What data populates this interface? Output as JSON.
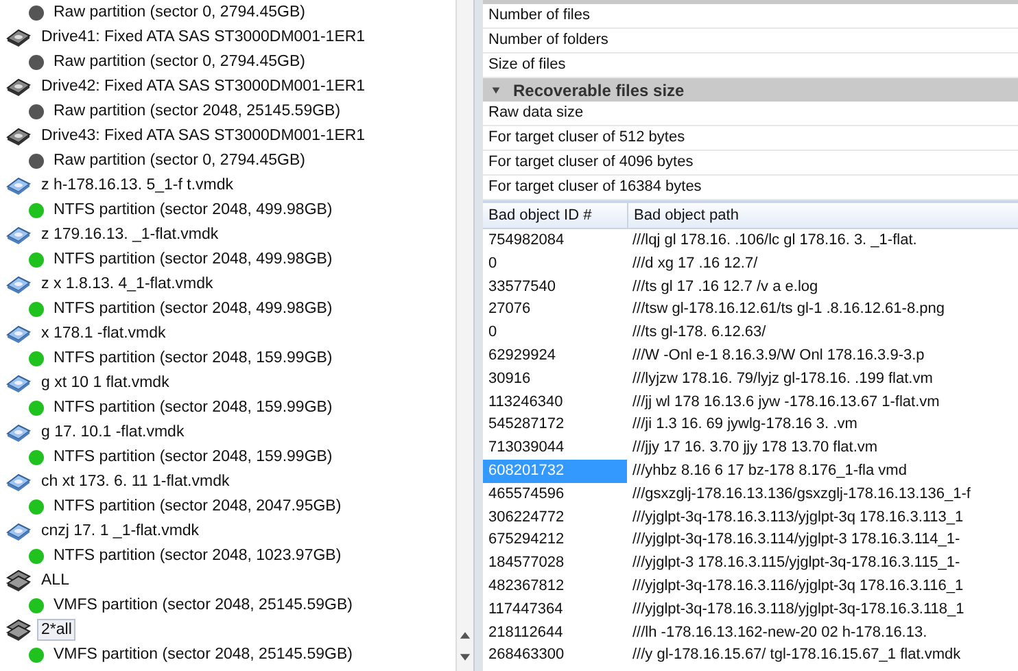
{
  "tree": [
    {
      "kind": "partition",
      "label": "Raw partition (sector 0, 2794.45GB)",
      "color": "#555555",
      "selected": false
    },
    {
      "kind": "drive",
      "label": "Drive41: Fixed ATA SAS ST3000DM001-1ER1",
      "selected": false,
      "children": [
        {
          "kind": "partition",
          "label": "Raw partition (sector 0, 2794.45GB)",
          "color": "#555555",
          "selected": false
        }
      ]
    },
    {
      "kind": "drive",
      "label": "Drive42: Fixed ATA SAS ST3000DM001-1ER1",
      "selected": false,
      "children": [
        {
          "kind": "partition",
          "label": "Raw partition (sector 2048, 25145.59GB)",
          "color": "#555555",
          "selected": false
        }
      ]
    },
    {
      "kind": "drive",
      "label": "Drive43: Fixed ATA SAS ST3000DM001-1ER1",
      "selected": false,
      "children": [
        {
          "kind": "partition",
          "label": "Raw partition (sector 0, 2794.45GB)",
          "color": "#555555",
          "selected": false
        }
      ]
    },
    {
      "kind": "image",
      "label": "z h-178.16.13. 5_1-f t.vmdk",
      "selected": false,
      "children": [
        {
          "kind": "partition",
          "label": "NTFS partition (sector 2048, 499.98GB)",
          "color": "#1fc21f",
          "selected": false
        }
      ]
    },
    {
      "kind": "image",
      "label": "z 179.16.13. _1-flat.vmdk",
      "selected": false,
      "children": [
        {
          "kind": "partition",
          "label": "NTFS partition (sector 2048, 499.98GB)",
          "color": "#1fc21f",
          "selected": false
        }
      ]
    },
    {
      "kind": "image",
      "label": "z x 1.8.13. 4_1-flat.vmdk",
      "selected": false,
      "children": [
        {
          "kind": "partition",
          "label": "NTFS partition (sector 2048, 499.98GB)",
          "color": "#1fc21f",
          "selected": false
        }
      ]
    },
    {
      "kind": "image",
      "label": "x 178.1 -flat.vmdk",
      "selected": false,
      "children": [
        {
          "kind": "partition",
          "label": "NTFS partition (sector 2048, 159.99GB)",
          "color": "#1fc21f",
          "selected": false
        }
      ]
    },
    {
      "kind": "image",
      "label": "g xt 10 1 flat.vmdk",
      "selected": false,
      "children": [
        {
          "kind": "partition",
          "label": "NTFS partition (sector 2048, 159.99GB)",
          "color": "#1fc21f",
          "selected": false
        }
      ]
    },
    {
      "kind": "image",
      "label": "g 17. 10.1 -flat.vmdk",
      "selected": false,
      "children": [
        {
          "kind": "partition",
          "label": "NTFS partition (sector 2048, 159.99GB)",
          "color": "#1fc21f",
          "selected": false
        }
      ]
    },
    {
      "kind": "image",
      "label": "ch xt 173. 6. 11 1-flat.vmdk",
      "selected": false,
      "children": [
        {
          "kind": "partition",
          "label": "NTFS partition (sector 2048, 2047.95GB)",
          "color": "#1fc21f",
          "selected": false
        }
      ]
    },
    {
      "kind": "image",
      "label": "cnzj 17. 1 _1-flat.vmdk",
      "selected": false,
      "children": [
        {
          "kind": "partition",
          "label": "NTFS partition (sector 2048, 1023.97GB)",
          "color": "#1fc21f",
          "selected": false
        }
      ]
    },
    {
      "kind": "group",
      "label": "ALL",
      "selected": false,
      "children": [
        {
          "kind": "partition",
          "label": "VMFS partition (sector 2048, 25145.59GB)",
          "color": "#1fc21f",
          "selected": false
        }
      ]
    },
    {
      "kind": "group",
      "label": "2*all",
      "selected": true,
      "children": [
        {
          "kind": "partition",
          "label": "VMFS partition (sector 2048, 25145.59GB)",
          "color": "#1fc21f",
          "selected": false
        }
      ]
    }
  ],
  "properties": [
    {
      "kind": "row",
      "label": "Number of files"
    },
    {
      "kind": "row",
      "label": "Number of folders"
    },
    {
      "kind": "row",
      "label": "Size of files"
    },
    {
      "kind": "section",
      "label": "Recoverable files size",
      "expanded": true
    },
    {
      "kind": "row",
      "label": "Raw data size"
    },
    {
      "kind": "row",
      "label": "For target cluser of 512 bytes"
    },
    {
      "kind": "row",
      "label": "For target cluser of 4096 bytes"
    },
    {
      "kind": "row",
      "label": "For target cluser of 16384 bytes"
    }
  ],
  "table": {
    "columns": [
      "Bad object ID #",
      "Bad object path"
    ],
    "rows": [
      {
        "id": "754982084",
        "path": "///lqj gl 178.16. .106/lc gl 178.16. 3. _1-flat.",
        "selected": false
      },
      {
        "id": "0",
        "path": "///d xg 17 .16 12.7/",
        "selected": false
      },
      {
        "id": "33577540",
        "path": "///ts gl 17 .16 12.7 /v a e.log",
        "selected": false
      },
      {
        "id": "27076",
        "path": "///tsw gl-178.16.12.61/ts gl-1 .8.16.12.61-8.png",
        "selected": false
      },
      {
        "id": "0",
        "path": "///ts gl-178. 6.12.63/",
        "selected": false
      },
      {
        "id": "62929924",
        "path": "///W -Onl e-1 8.16.3.9/W Onl 178.16.3.9-3.p",
        "selected": false
      },
      {
        "id": "30916",
        "path": "///lyjzw 178.16. 79/lyjz gl-178.16. .199 flat.vm",
        "selected": false
      },
      {
        "id": "113246340",
        "path": "///jj wl 178 16.13.6 jyw -178.16.13.67 1-flat.vm",
        "selected": false
      },
      {
        "id": "545287172",
        "path": "///ji 1.3 16. 69 jywlg-178.16 3. .vm",
        "selected": false
      },
      {
        "id": "713039044",
        "path": "///jjy 17 16. 3.70 jjy 178 13.70 flat.vm",
        "selected": false
      },
      {
        "id": "608201732",
        "path": "///yhbz 8.16 6 17 bz-178 8.176_1-fla vmd",
        "selected": true
      },
      {
        "id": "465574596",
        "path": "///gsxzglj-178.16.13.136/gsxzglj-178.16.13.136_1-f",
        "selected": false
      },
      {
        "id": "306224772",
        "path": "///yjglpt-3q-178.16.3.113/yjglpt-3q 178.16.3.113_1",
        "selected": false
      },
      {
        "id": "675294212",
        "path": "///yjglpt-3q-178.16.3.114/yjglpt-3 178.16.3.114_1-",
        "selected": false
      },
      {
        "id": "184577028",
        "path": "///yjglpt-3 178.16.3.115/yjglpt-3q-178.16.3.115_1-",
        "selected": false
      },
      {
        "id": "482367812",
        "path": "///yjglpt-3q-178.16.3.116/yjglpt-3q 178.16.3.116_1",
        "selected": false
      },
      {
        "id": "117447364",
        "path": "///yjglpt-3q-178.16.3.118/yjglpt-3q-178.16.3.118_1",
        "selected": false
      },
      {
        "id": "218112644",
        "path": "///lh -178.16.13.162-new-20 02 h-178.16.13.",
        "selected": false
      },
      {
        "id": "268463300",
        "path": "///y gl-178.16.15.67/ tgl-178.16.15.67_1 flat.vmdk",
        "selected": false
      }
    ]
  }
}
